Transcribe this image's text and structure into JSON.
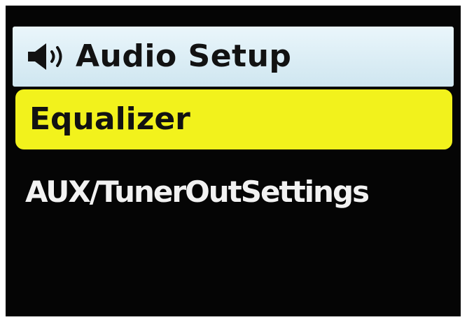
{
  "header": {
    "icon": "speaker-icon",
    "title": "Audio Setup"
  },
  "menu": {
    "items": [
      {
        "label": "Equalizer",
        "selected": true
      },
      {
        "label": "AUX/TunerOutSettings",
        "selected": false
      }
    ]
  },
  "colors": {
    "background": "#050505",
    "header": "#d8ecf4",
    "selected": "#f2f21c",
    "text_dark": "#121212",
    "text_light": "#f2f2f2"
  }
}
